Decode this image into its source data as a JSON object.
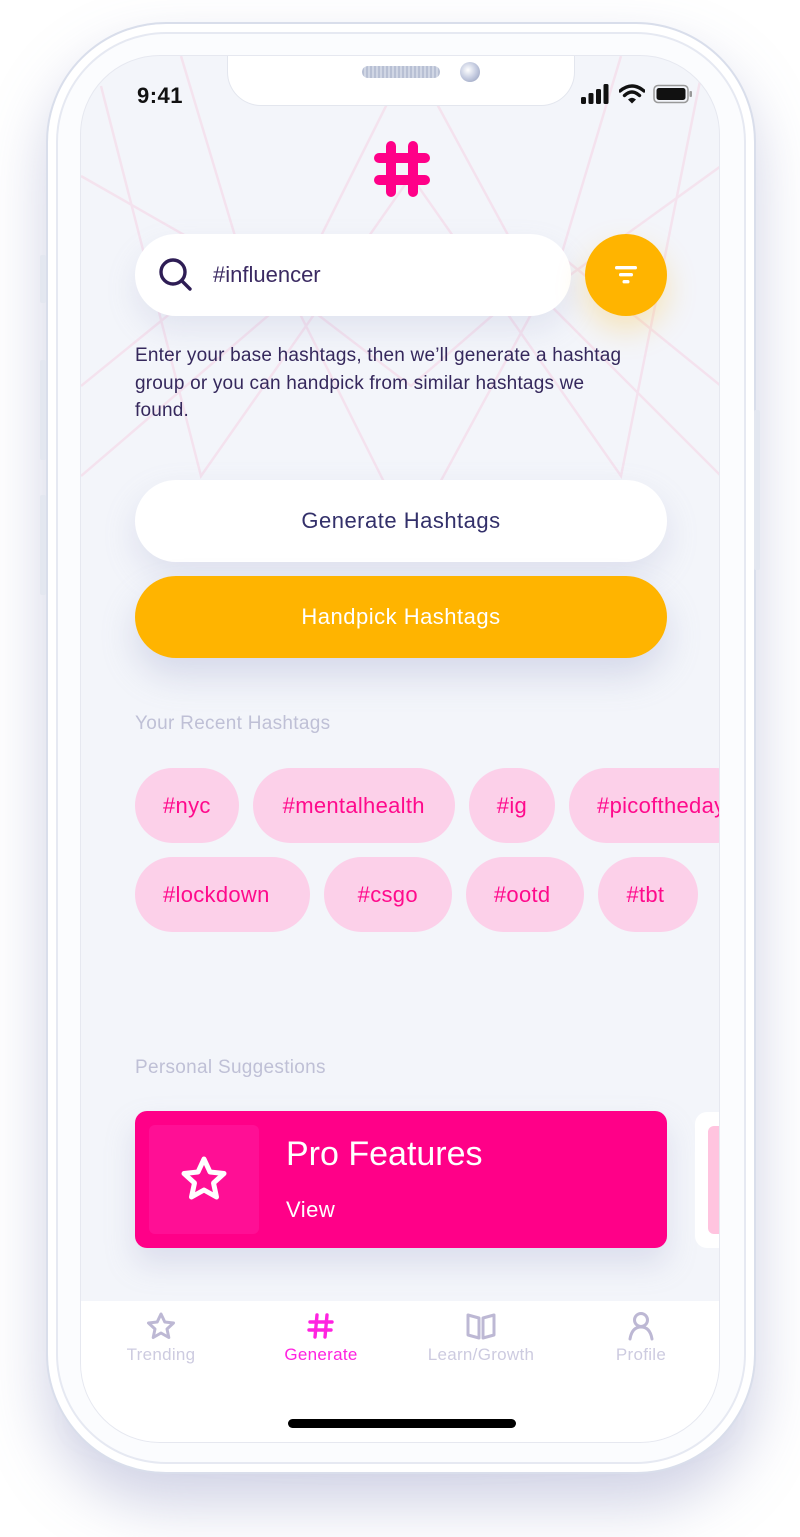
{
  "status_bar": {
    "time": "9:41",
    "icons": [
      "signal-icon",
      "wifi-icon",
      "battery-icon"
    ]
  },
  "app": {
    "logo_icon": "hashtag-heart-logo",
    "brand_color": "#ff0088",
    "accent_color": "#ffb400"
  },
  "search": {
    "icon": "search-icon",
    "value": "#influencer",
    "placeholder": "",
    "filter_icon": "filter-icon"
  },
  "helper_text": "Enter your base hashtags, then we’ll generate a hashtag group or you can handpick from similar hashtags we found.",
  "actions": {
    "generate_label": "Generate Hashtags",
    "handpick_label": "Handpick Hashtags"
  },
  "recent": {
    "label": "Your Recent Hashtags",
    "rows": [
      [
        "#nyc",
        "#mentalhealth",
        "#ig",
        "#picoftheday"
      ],
      [
        "#lockdown",
        "#csgo",
        "#ootd",
        "#tbt"
      ]
    ]
  },
  "suggestions": {
    "label": "Personal Suggestions",
    "cards": [
      {
        "icon": "star-icon",
        "title": "Pro Features",
        "link": "View"
      }
    ]
  },
  "tab_bar": {
    "tabs": [
      {
        "icon": "star-icon",
        "label": "Trending",
        "active": false
      },
      {
        "icon": "hashtag-icon",
        "label": "Generate",
        "active": true
      },
      {
        "icon": "book-icon",
        "label": "Learn/Growth",
        "active": false
      },
      {
        "icon": "user-icon",
        "label": "Profile",
        "active": false
      }
    ]
  }
}
